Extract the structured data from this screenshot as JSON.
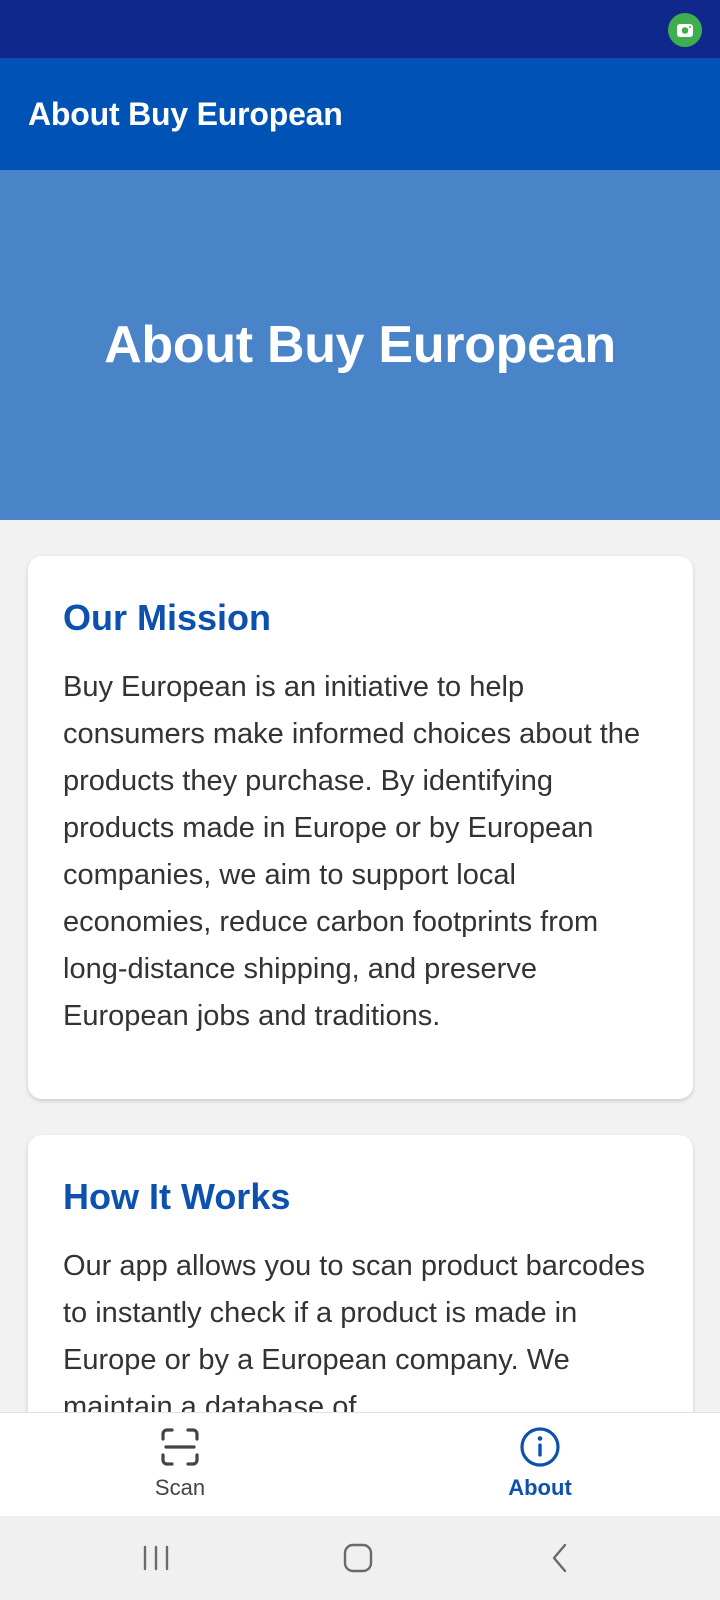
{
  "status_bar": {
    "indicator_icon": "camera-icon",
    "indicator_color": "#3fae4e"
  },
  "app_bar": {
    "title": "About Buy European",
    "color": "#0052b4"
  },
  "hero": {
    "title": "About Buy European",
    "color": "#4a84c8"
  },
  "sections": [
    {
      "title": "Our Mission",
      "body": "Buy European is an initiative to help consumers make informed choices about the products they purchase. By identifying products made in Europe or by European companies, we aim to support local economies, reduce carbon footprints from long-distance shipping, and preserve European jobs and traditions."
    },
    {
      "title": "How It Works",
      "body": "Our app allows you to scan product barcodes to instantly check if a product is made in Europe or by a European company. We maintain a database of"
    }
  ],
  "bottom_nav": {
    "items": [
      {
        "label": "Scan",
        "icon": "barcode-scan-icon",
        "active": false
      },
      {
        "label": "About",
        "icon": "info-icon",
        "active": true
      }
    ],
    "active_color": "#0b51ad"
  },
  "system_nav": {
    "buttons": [
      "recents-icon",
      "home-icon",
      "back-icon"
    ]
  }
}
